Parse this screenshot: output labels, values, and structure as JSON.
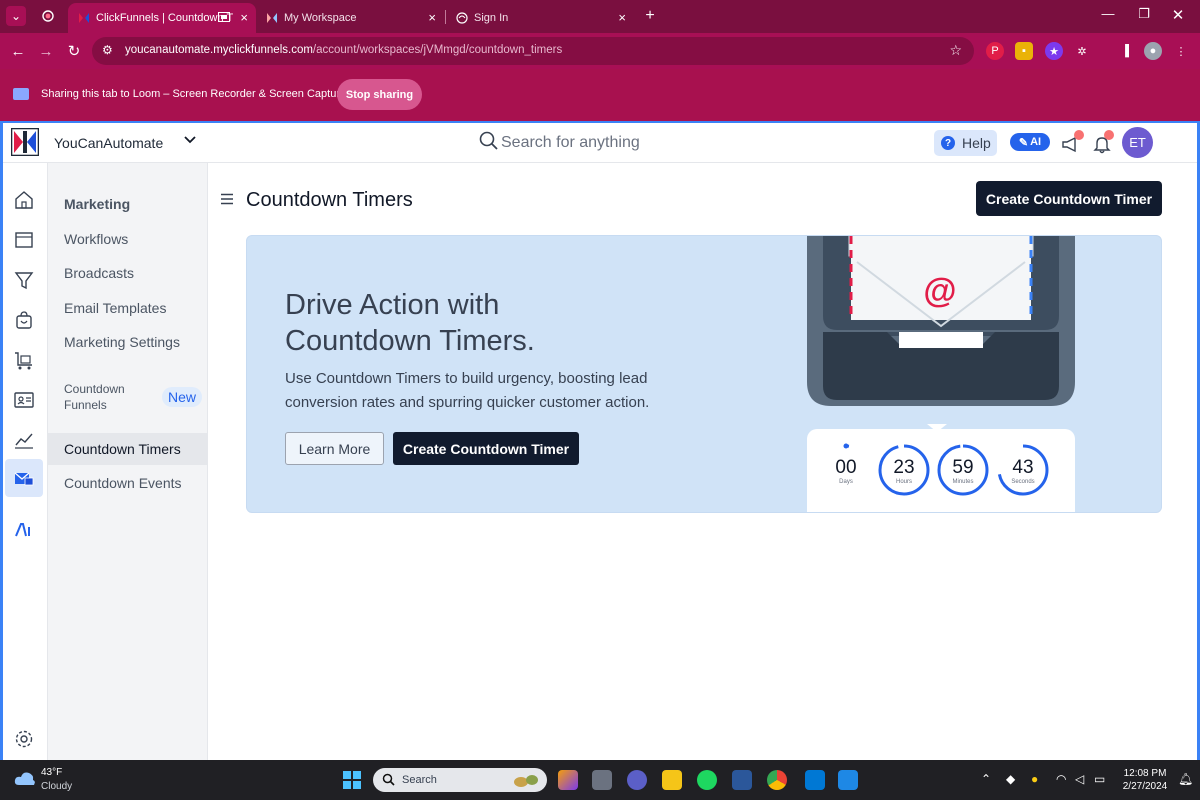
{
  "browser": {
    "tabs": [
      {
        "title": "ClickFunnels | Countdown T"
      },
      {
        "title": "My Workspace"
      },
      {
        "title": "Sign In"
      }
    ],
    "url_host": "youcanautomate.myclickfunnels.com",
    "url_path": "/account/workspaces/jVMmgd/countdown_timers"
  },
  "loom": {
    "message": "Sharing this tab to Loom – Screen Recorder & Screen Capture",
    "stop_label": "Stop sharing"
  },
  "app": {
    "workspace_name": "YouCanAutomate",
    "search_placeholder": "Search for anything",
    "help_label": "Help",
    "ai_label": "AI",
    "avatar_initials": "ET"
  },
  "subnav": {
    "heading": "Marketing",
    "items": [
      {
        "label": "Workflows"
      },
      {
        "label": "Broadcasts"
      },
      {
        "label": "Email Templates"
      },
      {
        "label": "Marketing Settings"
      },
      {
        "label": "Countdown Funnels",
        "badge": "New"
      },
      {
        "label": "Countdown Timers"
      },
      {
        "label": "Countdown Events"
      }
    ]
  },
  "main": {
    "title": "Countdown Timers",
    "create_label": "Create Countdown Timer",
    "banner": {
      "heading": "Drive Action with Countdown Timers.",
      "body": "Use Countdown Timers to build urgency, boosting lead conversion rates and spurring quicker customer action.",
      "learn_label": "Learn More",
      "create_label": "Create Countdown Timer",
      "at_symbol": "@",
      "timer": [
        {
          "value": "00",
          "unit": "Days",
          "fraction": 0.02
        },
        {
          "value": "23",
          "unit": "Hours",
          "fraction": 0.96
        },
        {
          "value": "59",
          "unit": "Minutes",
          "fraction": 0.98
        },
        {
          "value": "43",
          "unit": "Seconds",
          "fraction": 0.72
        }
      ]
    }
  },
  "taskbar": {
    "temperature": "43°F",
    "condition": "Cloudy",
    "search_label": "Search",
    "time": "12:08 PM",
    "date": "2/27/2024"
  },
  "colors": {
    "browser_frame": "#7a0f3f",
    "browser_active": "#a80f55",
    "accent_blue": "#2563eb",
    "dark_button": "#111b2e",
    "banner_bg": "#d0e3f7"
  }
}
